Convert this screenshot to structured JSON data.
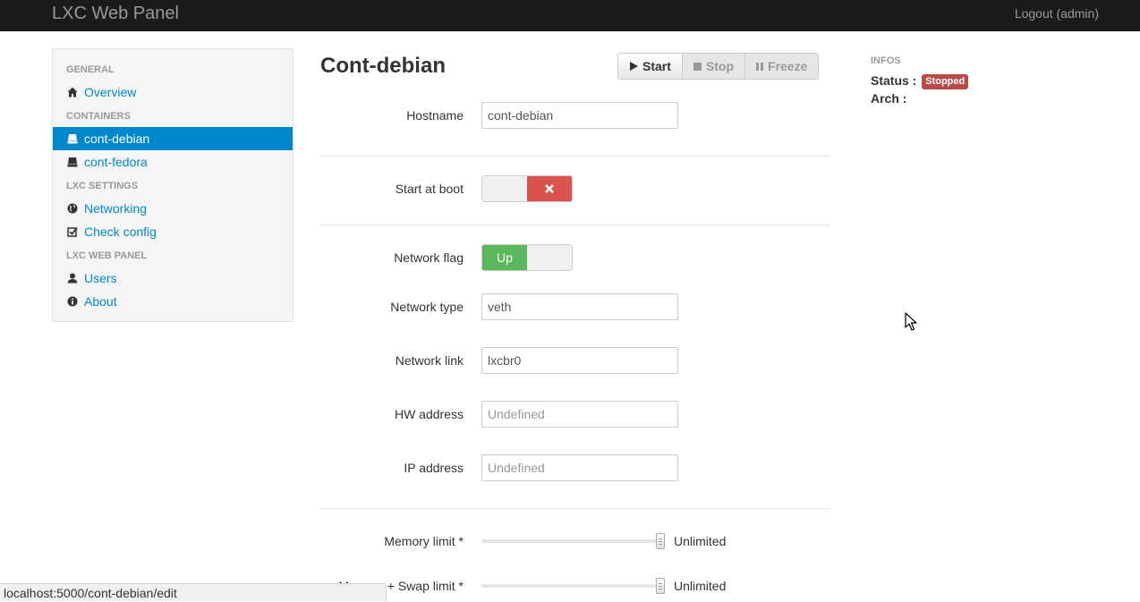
{
  "navbar": {
    "brand": "LXC Web Panel",
    "logout": "Logout (admin)"
  },
  "sidebar": {
    "headers": [
      "GENERAL",
      "CONTAINERS",
      "LXC SETTINGS",
      "LXC WEB PANEL"
    ],
    "items": [
      {
        "label": "Overview",
        "icon": "home-icon"
      },
      {
        "label": "cont-debian",
        "icon": "hdd-icon",
        "active": true
      },
      {
        "label": "cont-fedora",
        "icon": "hdd-icon"
      },
      {
        "label": "Networking",
        "icon": "globe-icon"
      },
      {
        "label": "Check config",
        "icon": "check-icon"
      },
      {
        "label": "Users",
        "icon": "user-icon"
      },
      {
        "label": "About",
        "icon": "info-icon"
      }
    ]
  },
  "main": {
    "title": "Cont-debian",
    "buttons": {
      "start": "Start",
      "stop": "Stop",
      "freeze": "Freeze"
    },
    "form": {
      "hostname_label": "Hostname",
      "hostname_value": "cont-debian",
      "start_at_boot_label": "Start at boot",
      "network_flag_label": "Network flag",
      "network_flag_value": "Up",
      "network_type_label": "Network type",
      "network_type_value": "veth",
      "network_link_label": "Network link",
      "network_link_value": "lxcbr0",
      "hw_address_label": "HW address",
      "hw_address_placeholder": "Undefined",
      "ip_address_label": "IP address",
      "ip_address_placeholder": "Undefined",
      "memory_limit_label": "Memory limit *",
      "memory_limit_value": "Unlimited",
      "memswap_limit_label": "Memory + Swap limit *",
      "memswap_limit_value": "Unlimited"
    }
  },
  "infos": {
    "header": "INFOS",
    "status_label": "Status :",
    "status_value": "Stopped",
    "arch_label": "Arch :"
  },
  "statusbar": {
    "url": "localhost:5000/cont-debian/edit"
  },
  "colors": {
    "navbar_bg": "#1b1b1b",
    "link": "#0088cc",
    "danger": "#d9534f",
    "success": "#5cb85c",
    "badge_stopped": "#b94a48"
  }
}
